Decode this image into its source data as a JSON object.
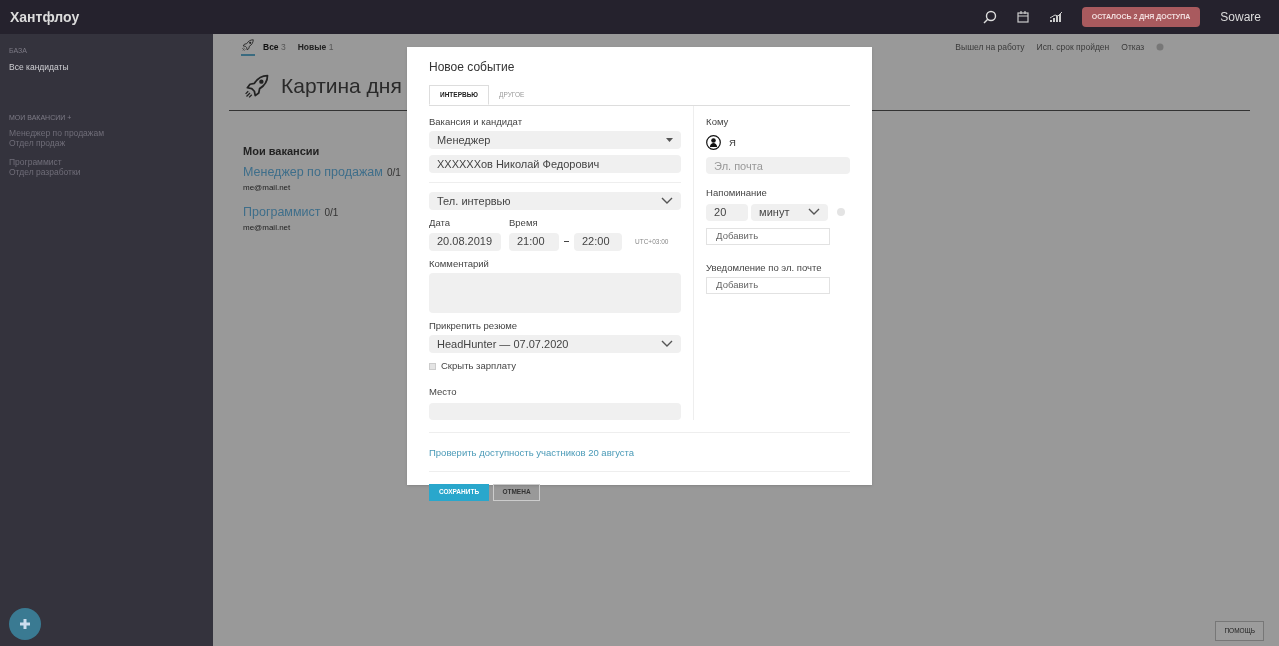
{
  "header": {
    "logo": "Хантфлоу",
    "trial_badge": "ОСТАЛОСЬ 2 ДНЯ ДОСТУПА",
    "account": "Soware"
  },
  "sidebar": {
    "sections": [
      {
        "title": "БАЗА",
        "items": [
          {
            "label": "Все кандидаты"
          }
        ]
      },
      {
        "title": "МОИ ВАКАНСИИ +",
        "items": [
          {
            "label": "Менеджер по продажам",
            "sub": "Отдел продаж"
          },
          {
            "label": "Программист",
            "sub": "Отдел разработки"
          }
        ]
      }
    ]
  },
  "status_tabs": [
    {
      "label": "Все",
      "count": "3",
      "selected": true
    },
    {
      "label": "Новые",
      "count": "1",
      "selected": false
    },
    {
      "label": "Вышел на работу",
      "selected": false
    },
    {
      "label": "Исп. срок пройден",
      "selected": false
    },
    {
      "label": "Отказ",
      "selected": false
    }
  ],
  "page": {
    "title": "Картина дня",
    "section_title": "Мои вакансии",
    "vacancies": [
      {
        "name": "Менеджер по продажам",
        "count": "0/1",
        "email": "me@mail.net"
      },
      {
        "name": "Программист",
        "count": "0/1",
        "email": "me@mail.net"
      }
    ]
  },
  "dialog": {
    "title": "Новое событие",
    "tabs": [
      {
        "label": "ИНТЕРВЬЮ",
        "selected": true
      },
      {
        "label": "ДРУГОЕ",
        "selected": false
      }
    ],
    "vacancy_label": "Вакансия и кандидат",
    "vacancy": "Менеджер",
    "candidate": "ХХХХХХов Николай Федорович",
    "event_type": "Тел. интервью",
    "date_label": "Дата",
    "date": "20.08.2019",
    "time_label": "Время",
    "time_from": "21:00",
    "time_to": "22:00",
    "timezone": "UTC+03:00",
    "comment_label": "Комментарий",
    "resume_label": "Прикрепить резюме",
    "resume": "HeadHunter — 07.07.2020",
    "hide_salary": {
      "label": "Скрыть зарплату",
      "checked": false
    },
    "place_label": "Место",
    "to_label": "Кому",
    "recipient": "Я",
    "email_placeholder": "Эл. почта",
    "reminder_label": "Напоминание",
    "reminder_value": "20",
    "reminder_unit": "минут",
    "reminder_add": "Добавить",
    "notify_label": "Уведомление по эл. почте",
    "notify_add": "Добавить",
    "check_link": "Проверить доступность участников 20 августа",
    "save": "СОХРАНИТЬ",
    "cancel": "ОТМЕНА"
  },
  "help_button": "ПОМОЩЬ"
}
